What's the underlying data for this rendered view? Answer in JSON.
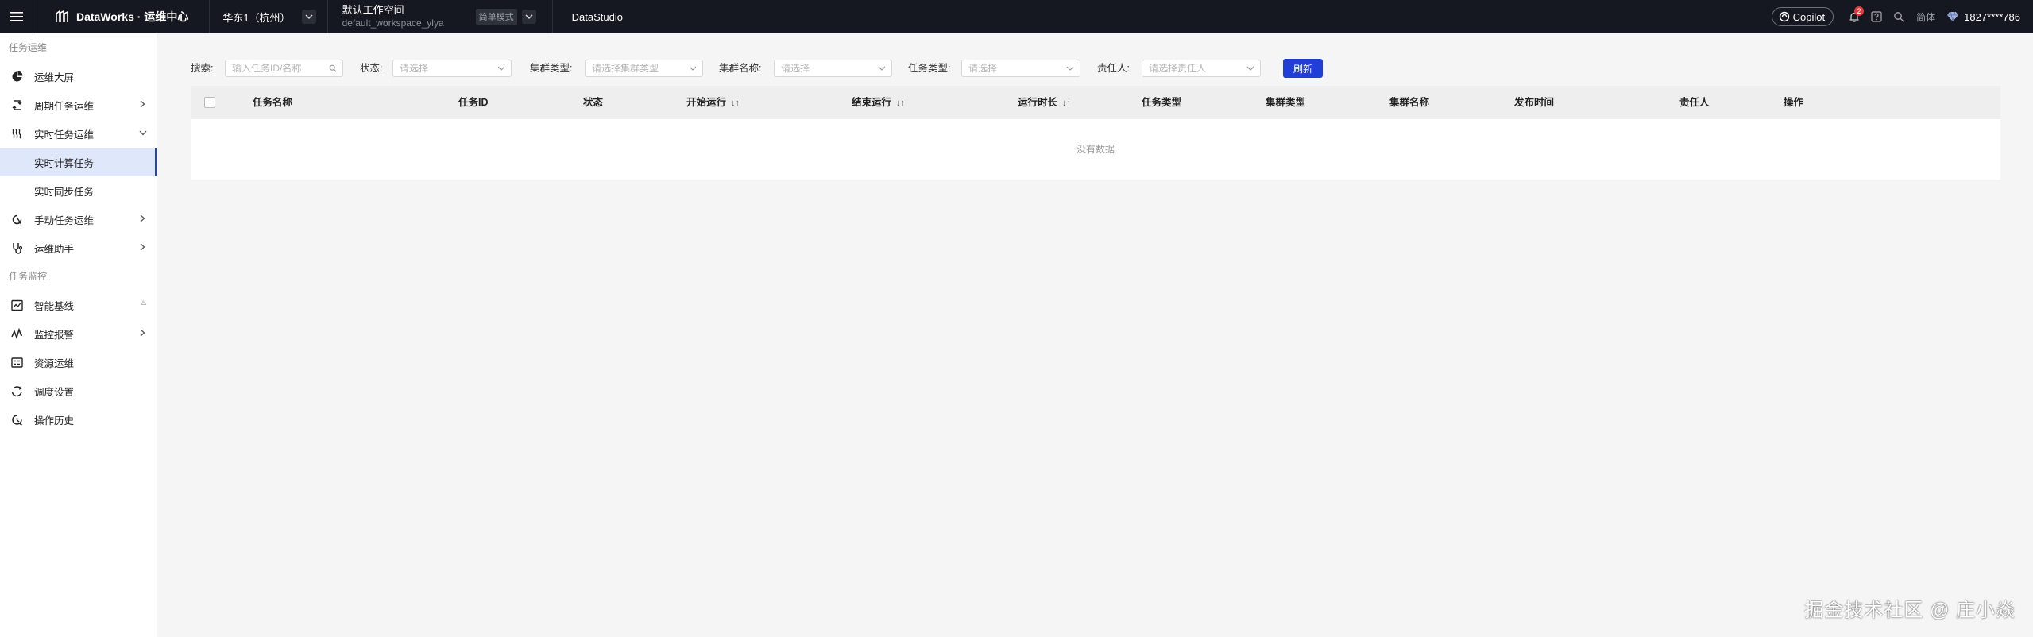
{
  "topbar": {
    "brand": "DataWorks · 运维中心",
    "region": "华东1（杭州）",
    "workspace_title": "默认工作空间",
    "workspace_sub": "default_workspace_ylya",
    "mode": "简单模式",
    "datastudio": "DataStudio",
    "copilot": "Copilot",
    "notification_count": "2",
    "lang": "简体",
    "user": "1827****786"
  },
  "sidebar": {
    "group1": "任务运维",
    "items1": [
      {
        "label": "运维大屏",
        "icon": "pie-chart-icon"
      },
      {
        "label": "周期任务运维",
        "icon": "cycle-icon"
      },
      {
        "label": "实时任务运维",
        "icon": "wave-icon"
      },
      {
        "label": "实时计算任务"
      },
      {
        "label": "实时同步任务"
      },
      {
        "label": "手动任务运维",
        "icon": "manual-icon"
      },
      {
        "label": "运维助手",
        "icon": "assistant-icon"
      }
    ],
    "group2": "任务监控",
    "items2": [
      {
        "label": "智能基线",
        "icon": "baseline-icon"
      },
      {
        "label": "监控报警",
        "icon": "alarm-icon"
      },
      {
        "label": "资源运维",
        "icon": "resource-icon"
      },
      {
        "label": "调度设置",
        "icon": "schedule-icon"
      },
      {
        "label": "操作历史",
        "icon": "history-icon"
      }
    ]
  },
  "filters": {
    "search_label": "搜索:",
    "search_placeholder": "输入任务ID/名称",
    "status_label": "状态:",
    "status_placeholder": "请选择",
    "cluster_type_label": "集群类型:",
    "cluster_type_placeholder": "请选择集群类型",
    "cluster_name_label": "集群名称:",
    "cluster_name_placeholder": "请选择",
    "task_type_label": "任务类型:",
    "task_type_placeholder": "请选择",
    "owner_label": "责任人:",
    "owner_placeholder": "请选择责任人",
    "refresh": "刷新"
  },
  "table": {
    "columns": [
      "任务名称",
      "任务ID",
      "状态",
      "开始运行",
      "结束运行",
      "运行时长",
      "任务类型",
      "集群类型",
      "集群名称",
      "发布时间",
      "责任人",
      "操作"
    ],
    "empty": "没有数据"
  },
  "watermark": "掘金技术社区 @ 庄小焱"
}
